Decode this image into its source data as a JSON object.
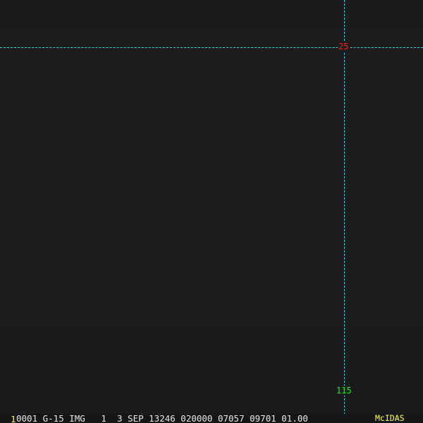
{
  "overlay": {
    "latitude_label": "25",
    "longitude_label": "115",
    "grid_color": "#33d6e6",
    "latitude_color": "#ff2020",
    "longitude_color": "#22ee22"
  },
  "status_bar": {
    "frame_number": "1",
    "info_text": "0001 G-15 IMG   1  3 SEP 13246 020000 07057 09701 01.00",
    "brand": "McIDAS"
  }
}
